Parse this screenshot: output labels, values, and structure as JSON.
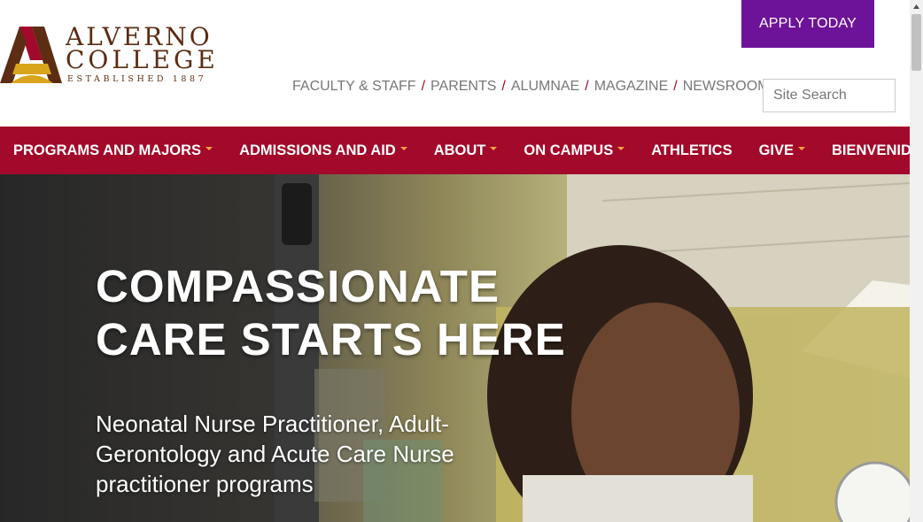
{
  "brand": {
    "name_line1": "ALVERNO",
    "name_line2": "COLLEGE",
    "established": "ESTABLISHED 1887",
    "colors": {
      "gold": "#d9a51d",
      "brown": "#5c2d13",
      "maroon": "#a3092a"
    }
  },
  "header": {
    "apply_label": "APPLY TODAY",
    "utility_links": [
      "FACULTY & STAFF",
      "PARENTS",
      "ALUMNAE",
      "MAGAZINE",
      "NEWSROOM"
    ],
    "separator": "/",
    "search": {
      "placeholder": "Site Search",
      "value": ""
    }
  },
  "nav": {
    "items": [
      {
        "label": "PROGRAMS AND MAJORS",
        "dropdown": true
      },
      {
        "label": "ADMISSIONS AND AID",
        "dropdown": true
      },
      {
        "label": "ABOUT",
        "dropdown": true
      },
      {
        "label": "ON CAMPUS",
        "dropdown": true
      },
      {
        "label": "ATHLETICS",
        "dropdown": false
      },
      {
        "label": "GIVE",
        "dropdown": true
      },
      {
        "label": "BIENVENIDO",
        "dropdown": false
      }
    ],
    "background": "#a3092a",
    "caret_color": "#f2a541"
  },
  "hero": {
    "title_line1": "COMPASSIONATE",
    "title_line2": "CARE STARTS HERE",
    "subtitle": "Neonatal Nurse Practitioner, Adult-Gerontology and Acute Care Nurse practitioner programs"
  },
  "colors": {
    "apply_button": "#6c1399",
    "utility_link": "#777777"
  }
}
